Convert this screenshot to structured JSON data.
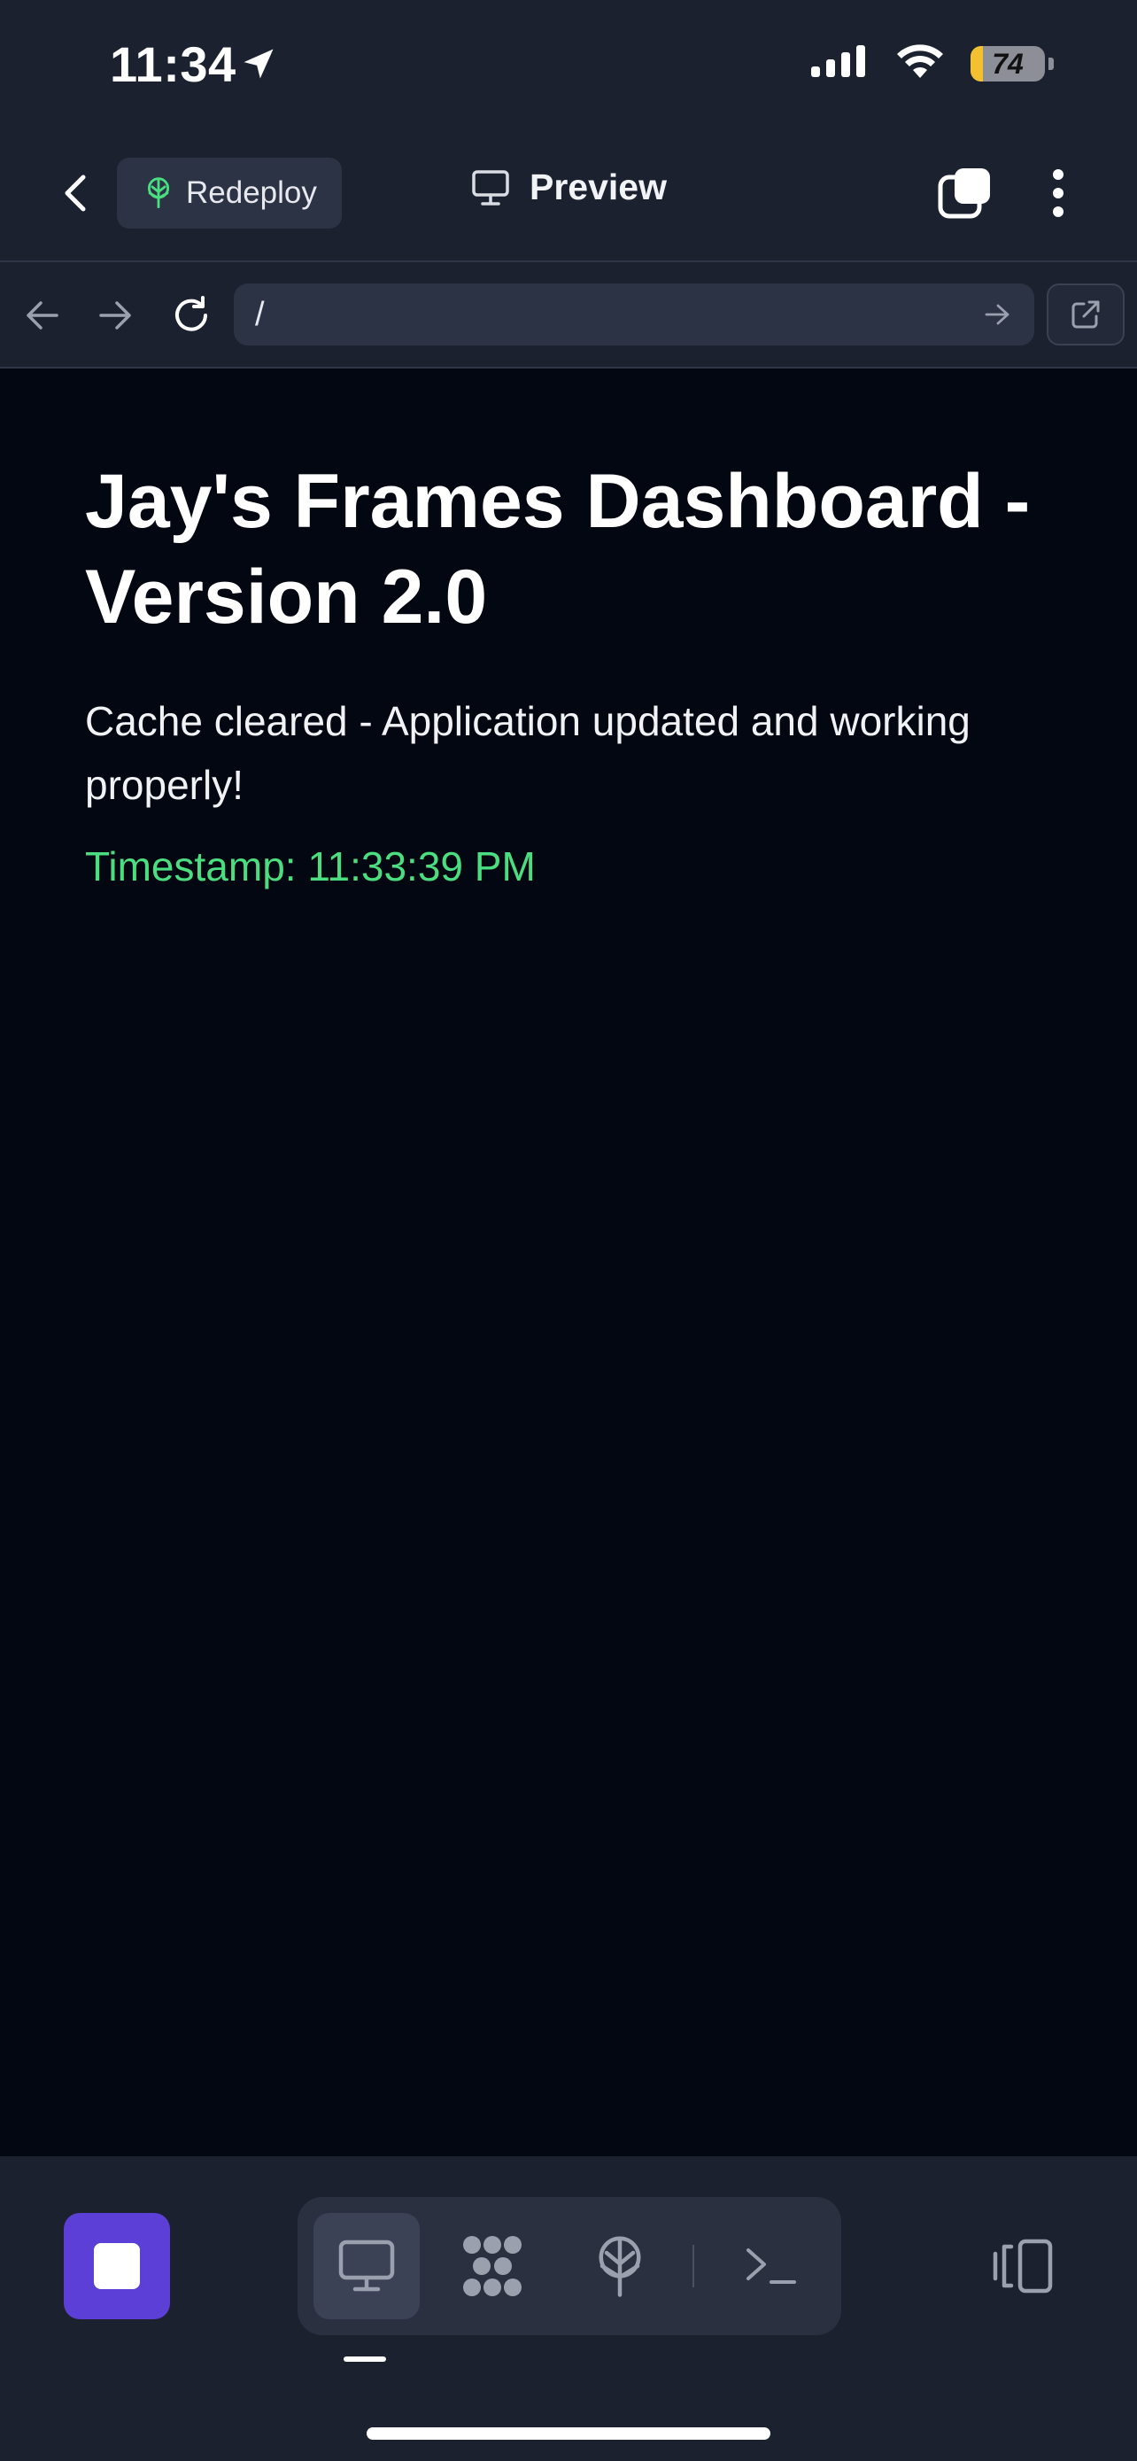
{
  "status_bar": {
    "time": "11:34",
    "battery_level": "74",
    "icons": [
      "location-arrow-icon",
      "cellular-signal-icon",
      "wifi-icon",
      "battery-charging-icon"
    ]
  },
  "header": {
    "back_icon": "chevron-left-icon",
    "redeploy_label": "Redeploy",
    "redeploy_icon": "deploy-tree-icon",
    "title": "Preview",
    "title_icon": "monitor-icon",
    "tabs_icon": "tabs-icon",
    "more_icon": "more-vertical-icon"
  },
  "url_bar": {
    "value": "/",
    "icons": [
      "arrow-back-icon",
      "arrow-forward-icon",
      "reload-icon",
      "go-arrow-icon",
      "open-external-icon"
    ]
  },
  "content": {
    "heading": "Jay's Frames Dashboard - Version 2.0",
    "message": "Cache cleared - Application updated and working properly!",
    "timestamp": "Timestamp: 11:33:39 PM"
  },
  "toolbar": {
    "items": [
      {
        "name": "stop-icon",
        "active": false
      },
      {
        "name": "monitor-icon",
        "active": true
      },
      {
        "name": "workflows-icon",
        "active": false
      },
      {
        "name": "deploy-tree-icon",
        "active": false
      },
      {
        "name": "terminal-icon",
        "active": false
      },
      {
        "name": "device-toggle-icon",
        "active": false
      }
    ]
  },
  "colors": {
    "app_bg": "#1c2130",
    "web_bg": "#030712",
    "accent_stop": "#5b3fd6",
    "timestamp_green": "#4ade80",
    "deploy_green": "#4ade80",
    "battery_yellow": "#f3c12f"
  }
}
